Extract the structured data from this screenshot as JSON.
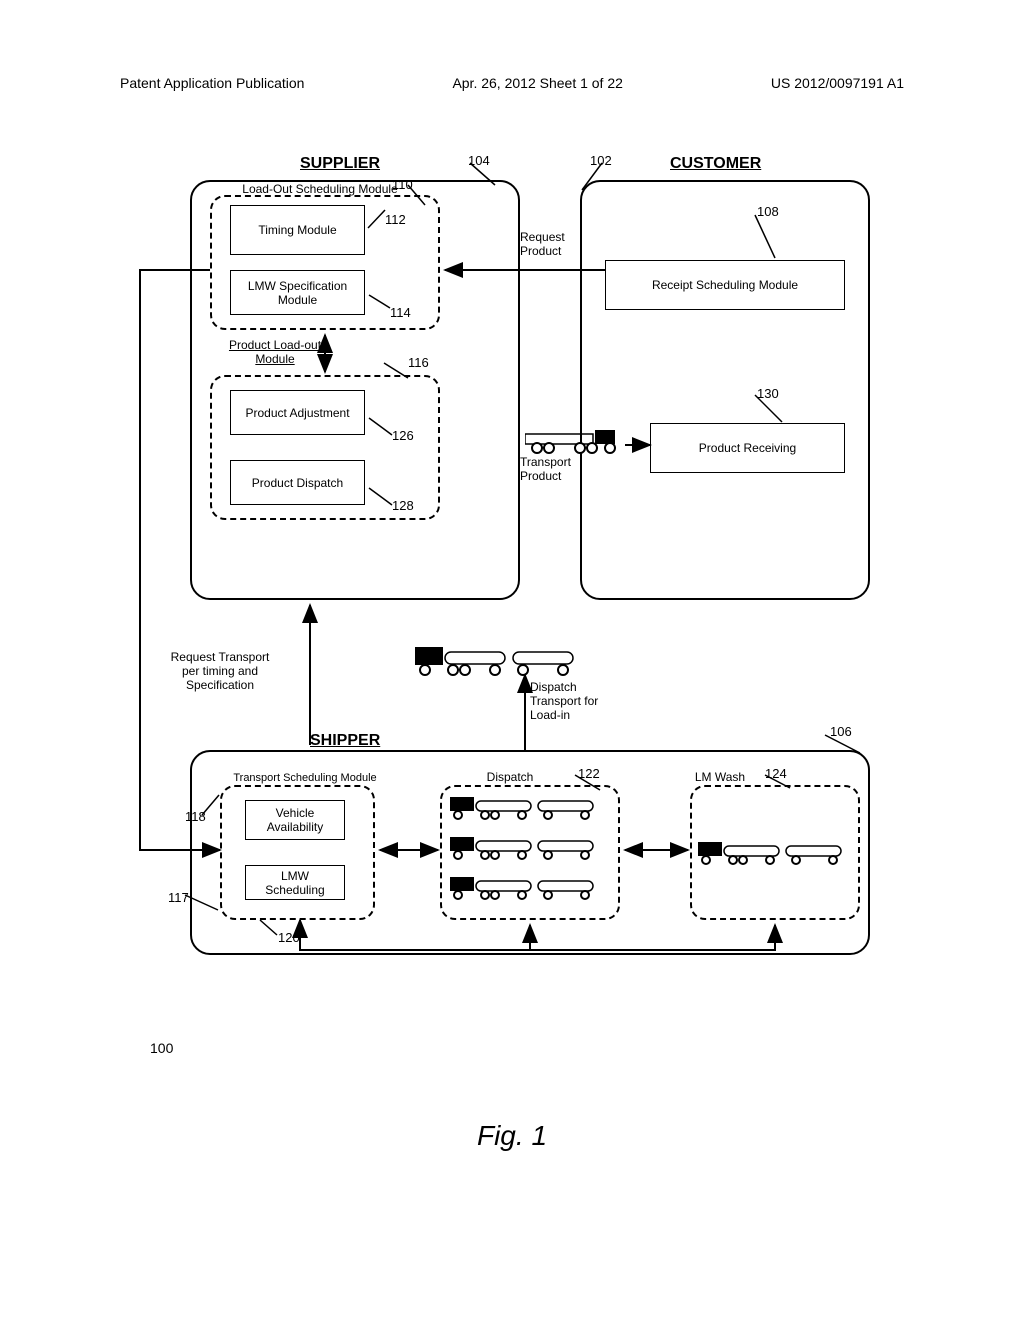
{
  "header": {
    "left": "Patent Application Publication",
    "center": "Apr. 26, 2012  Sheet 1 of 22",
    "right": "US 2012/0097191 A1"
  },
  "sections": {
    "supplier": "SUPPLIER",
    "customer": "CUSTOMER",
    "shipper": "SHIPPER"
  },
  "modules": {
    "load_out": "Load-Out Scheduling Module",
    "timing": "Timing Module",
    "lmw_spec": "LMW Specification Module",
    "product_loadout": "Product Load-out Module",
    "product_adj": "Product Adjustment",
    "product_dispatch": "Product Dispatch",
    "receipt_sched": "Receipt Scheduling Module",
    "product_receiving": "Product Receiving",
    "transport_sched": "Transport Scheduling Module",
    "vehicle_avail": "Vehicle Availability",
    "lmw_scheduling": "LMW Scheduling",
    "dispatch": "Dispatch",
    "lm_wash": "LM Wash"
  },
  "labels": {
    "request_product": "Request Product",
    "transport_product": "Transport Product",
    "request_transport": "Request Transport per timing and Specification",
    "dispatch_transport": "Dispatch Transport for Load-in"
  },
  "refs": {
    "r100": "100",
    "r102": "102",
    "r104": "104",
    "r106": "106",
    "r108": "108",
    "r110": "110",
    "r112": "112",
    "r114": "114",
    "r116": "116",
    "r117": "117",
    "r118": "118",
    "r120": "120",
    "r122": "122",
    "r124": "124",
    "r126": "126",
    "r128": "128",
    "r130": "130"
  },
  "figure": "Fig. 1"
}
